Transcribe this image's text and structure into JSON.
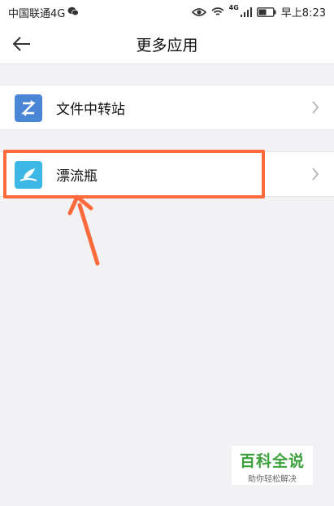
{
  "status_bar": {
    "carrier": "中国联通4G",
    "network_badge": "4G",
    "time": "早上8:23",
    "icons": [
      "wechat-icon",
      "eye-icon",
      "wifi-icon",
      "signal-icon",
      "battery-icon"
    ]
  },
  "header": {
    "title": "更多应用",
    "back_icon": "arrow-left-icon"
  },
  "apps": [
    {
      "label": "文件中转站",
      "icon": "file-transfer-icon",
      "icon_color": "#4b86d6"
    },
    {
      "label": "漂流瓶",
      "icon": "drift-bottle-icon",
      "icon_color": "#3db8e6"
    }
  ],
  "annotation": {
    "highlight_color": "#ff6a3d"
  },
  "watermark": {
    "title": "百科全说",
    "subtitle": "助你轻松解决"
  }
}
